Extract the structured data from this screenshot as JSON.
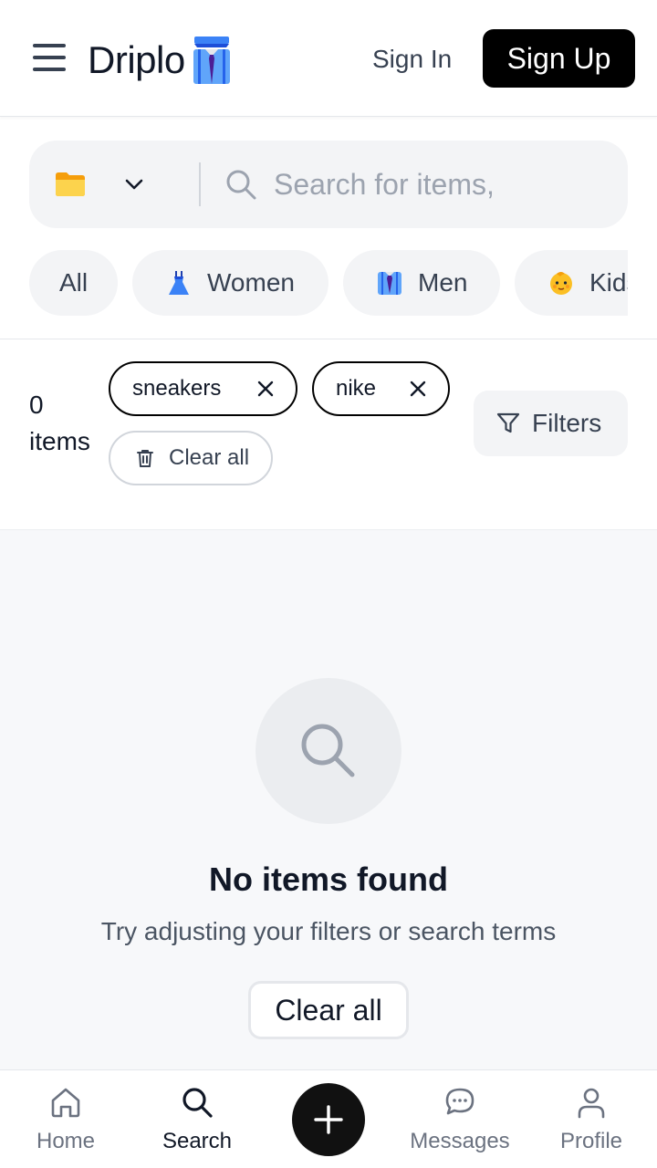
{
  "header": {
    "brand": "Driplo",
    "sign_in_label": "Sign In",
    "sign_up_label": "Sign Up"
  },
  "search": {
    "placeholder": "Search for items,",
    "value": ""
  },
  "categories": [
    {
      "label": "All",
      "icon": "none"
    },
    {
      "label": "Women",
      "icon": "dress-icon"
    },
    {
      "label": "Men",
      "icon": "shirt-tie-icon"
    },
    {
      "label": "Kids",
      "icon": "baby-icon"
    }
  ],
  "results": {
    "count": "0",
    "count_unit": "items",
    "active_filters": [
      {
        "label": "sneakers"
      },
      {
        "label": "nike"
      }
    ],
    "clear_all_label": "Clear all",
    "filters_label": "Filters"
  },
  "empty_state": {
    "title": "No items found",
    "subtitle": "Try adjusting your filters or search terms",
    "button_label": "Clear all"
  },
  "bottom_nav": {
    "items": [
      {
        "label": "Home",
        "icon": "home-icon",
        "active": false
      },
      {
        "label": "Search",
        "icon": "search-icon",
        "active": true
      },
      {
        "label": "Messages",
        "icon": "chat-icon",
        "active": false
      },
      {
        "label": "Profile",
        "icon": "user-icon",
        "active": false
      }
    ],
    "add_icon": "plus-icon"
  },
  "colors": {
    "primary": "#000000",
    "surface": "#f3f4f6",
    "muted_text": "#6b7280",
    "empty_bg": "#f7f8fa"
  }
}
